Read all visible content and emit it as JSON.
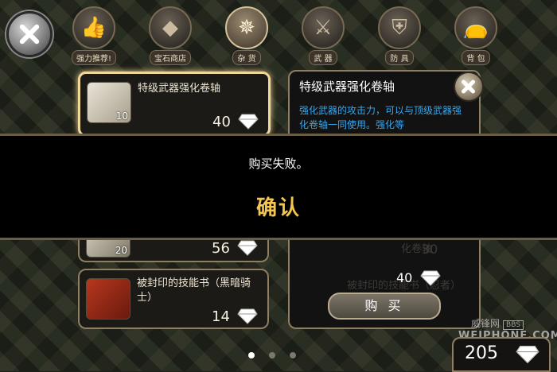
{
  "tabs": [
    {
      "label": "强力推荐!",
      "icon": "thumbs-up-icon",
      "glyph": "👍"
    },
    {
      "label": "宝石商店",
      "icon": "diamond-icon",
      "glyph": "◆"
    },
    {
      "label": "杂 货",
      "icon": "compass-icon",
      "glyph": "✵"
    },
    {
      "label": "武 器",
      "icon": "sword-icon",
      "glyph": "⚔"
    },
    {
      "label": "防 具",
      "icon": "shield-icon",
      "glyph": "⛨"
    },
    {
      "label": "背 包",
      "icon": "bag-icon",
      "glyph": "👝"
    }
  ],
  "active_tab": "杂 货",
  "items": [
    {
      "name": "特级武器强化卷轴",
      "qty": "10",
      "price": "40"
    },
    {
      "name": "",
      "qty": "20",
      "price": "56"
    },
    {
      "name": "被封印的技能书（黑暗骑士）",
      "qty": "",
      "price": "14"
    }
  ],
  "detail": {
    "title": "特级武器强化卷轴",
    "description": "强化武器的攻击力，可以与顶级武器强化卷轴一同使用。强化等",
    "ghost_name1": "化卷轴",
    "ghost_price1": "30",
    "ghost_name2": "被封印的技能书（忍者）",
    "price": "40",
    "buy_label": "购 买"
  },
  "dialog": {
    "message": "购买失败。",
    "confirm_label": "确认"
  },
  "currency": {
    "balance": "205"
  },
  "pagination": {
    "pages": 3,
    "current": 1
  },
  "watermark": {
    "cn": "威锋网",
    "bbs": "BBS",
    "en": "WEIPHONE.COM"
  },
  "colors": {
    "accent_gold": "#f4c64f",
    "desc_blue": "#39a6ea",
    "frame": "#8f7e60"
  }
}
